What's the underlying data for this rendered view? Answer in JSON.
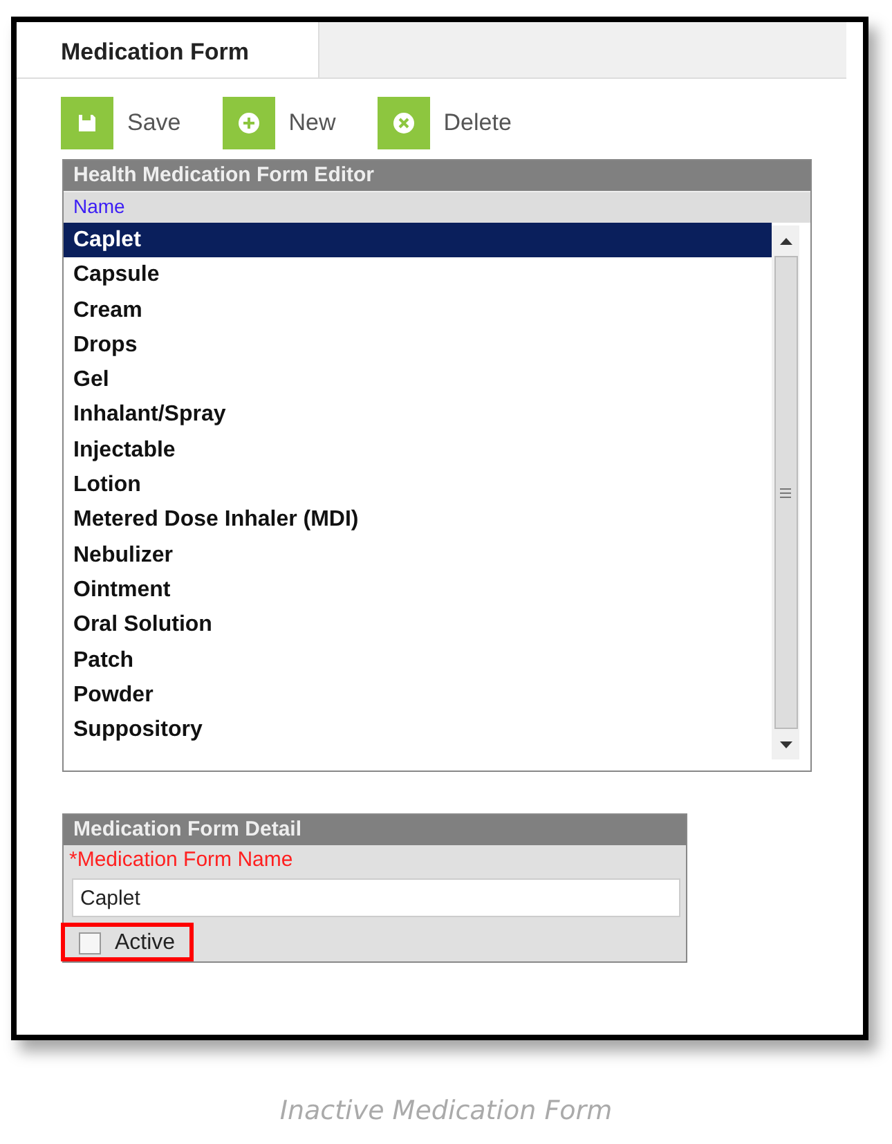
{
  "tabs": [
    {
      "label": "Medication Form",
      "selected": true
    }
  ],
  "toolbar": [
    {
      "kind": "save",
      "label": "Save"
    },
    {
      "kind": "new",
      "label": "New"
    },
    {
      "kind": "delete",
      "label": "Delete"
    }
  ],
  "editor": {
    "title": "Health Medication Form Editor",
    "column": "Name",
    "rows": [
      {
        "name": "Caplet",
        "selected": true
      },
      {
        "name": "Capsule",
        "selected": false
      },
      {
        "name": "Cream",
        "selected": false
      },
      {
        "name": "Drops",
        "selected": false
      },
      {
        "name": "Gel",
        "selected": false
      },
      {
        "name": "Inhalant/Spray",
        "selected": false
      },
      {
        "name": "Injectable",
        "selected": false
      },
      {
        "name": "Lotion",
        "selected": false
      },
      {
        "name": "Metered Dose Inhaler (MDI)",
        "selected": false
      },
      {
        "name": "Nebulizer",
        "selected": false
      },
      {
        "name": "Ointment",
        "selected": false
      },
      {
        "name": "Oral Solution",
        "selected": false
      },
      {
        "name": "Patch",
        "selected": false
      },
      {
        "name": "Powder",
        "selected": false
      },
      {
        "name": "Suppository",
        "selected": false
      }
    ]
  },
  "detail": {
    "title": "Medication Form Detail",
    "field_label": "*Medication Form Name",
    "field_value": "Caplet",
    "checkbox": {
      "label": "Active",
      "checked": false,
      "highlighted": true
    }
  },
  "caption": "Inactive Medication Form"
}
